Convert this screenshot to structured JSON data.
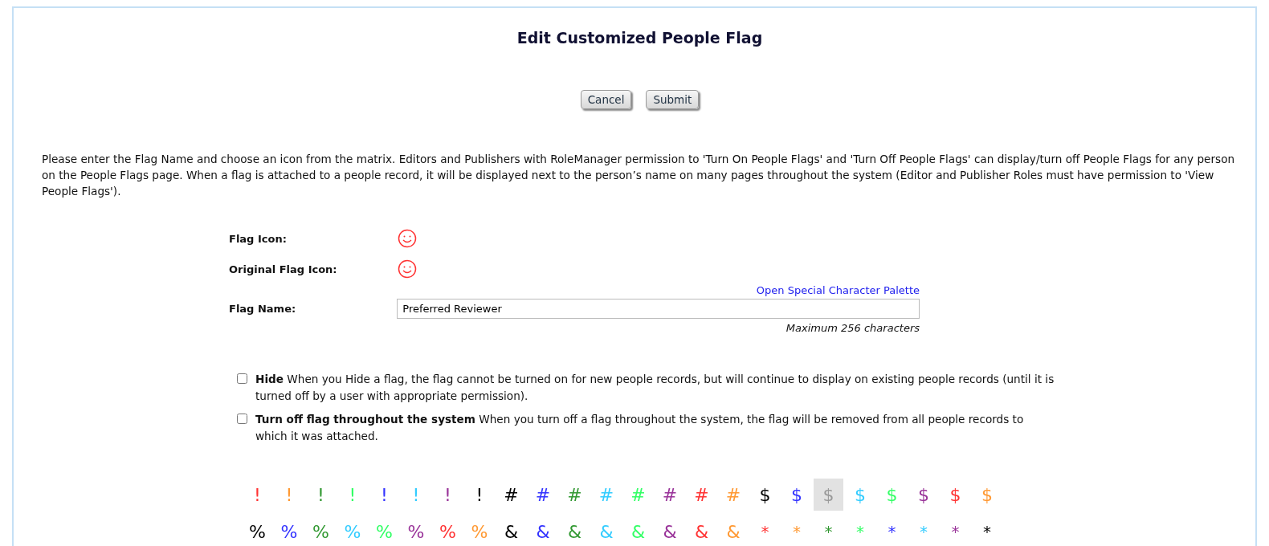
{
  "title": "Edit Customized People Flag",
  "buttons": [
    {
      "label": "Cancel"
    },
    {
      "label": "Submit"
    }
  ],
  "instructions": "Please enter the Flag Name and choose an icon from the matrix. Editors and Publishers with RoleManager permission to 'Turn On People Flags' and 'Turn Off People Flags' can display/turn off People Flags for any person on the People Flags page. When a flag is attached to a people record, it will be displayed next to the person’s name on many pages throughout the system (Editor and Publisher Roles must have permission to 'View People Flags').",
  "flag_icon": {
    "label": "Flag Icon:",
    "color": "#ff3333"
  },
  "original_flag_icon": {
    "label": "Original Flag Icon:",
    "color": "#ff3333"
  },
  "palette_link": "Open Special Character Palette",
  "flag_name": {
    "label": "Flag Name:",
    "value": "Preferred Reviewer",
    "hint": "Maximum 256 characters"
  },
  "options": [
    {
      "title": "Hide",
      "text": "When you Hide a flag, the flag cannot be turned on for new people records, but will continue to display on existing people records (until it is turned off by a user with appropriate permission).",
      "checked": false
    },
    {
      "title": "Turn off flag throughout the system",
      "text": "When you turn off a flag throughout the system, the flag will be removed from all people records to which it was attached.",
      "checked": false
    }
  ],
  "icon_matrix": [
    [
      {
        "char": "!",
        "color": "#ff3333",
        "selected": false
      },
      {
        "char": "!",
        "color": "#ff9933",
        "selected": false
      },
      {
        "char": "!",
        "color": "#339933",
        "selected": false
      },
      {
        "char": "!",
        "color": "#33ff66",
        "selected": false
      },
      {
        "char": "!",
        "color": "#3333ff",
        "selected": false
      },
      {
        "char": "!",
        "color": "#33ccff",
        "selected": false
      },
      {
        "char": "!",
        "color": "#993399",
        "selected": false
      },
      {
        "char": "!",
        "color": "#000000",
        "selected": false
      },
      {
        "char": "#",
        "color": "#000000",
        "selected": false
      },
      {
        "char": "#",
        "color": "#3333ff",
        "selected": false
      },
      {
        "char": "#",
        "color": "#339933",
        "selected": false
      },
      {
        "char": "#",
        "color": "#33ccff",
        "selected": false
      },
      {
        "char": "#",
        "color": "#33ff66",
        "selected": false
      },
      {
        "char": "#",
        "color": "#993399",
        "selected": false
      },
      {
        "char": "#",
        "color": "#ff3333",
        "selected": false
      },
      {
        "char": "#",
        "color": "#ff9933",
        "selected": false
      },
      {
        "char": "$",
        "color": "#000000",
        "selected": false
      },
      {
        "char": "$",
        "color": "#3333ff",
        "selected": false
      },
      {
        "char": "$",
        "color": "#999999",
        "selected": true
      },
      {
        "char": "$",
        "color": "#33ccff",
        "selected": false
      },
      {
        "char": "$",
        "color": "#33ff66",
        "selected": false
      },
      {
        "char": "$",
        "color": "#993399",
        "selected": false
      },
      {
        "char": "$",
        "color": "#ff3333",
        "selected": false
      },
      {
        "char": "$",
        "color": "#ff9933",
        "selected": false
      }
    ],
    [
      {
        "char": "%",
        "color": "#000000",
        "selected": false
      },
      {
        "char": "%",
        "color": "#3333ff",
        "selected": false
      },
      {
        "char": "%",
        "color": "#339933",
        "selected": false
      },
      {
        "char": "%",
        "color": "#33ccff",
        "selected": false
      },
      {
        "char": "%",
        "color": "#33ff66",
        "selected": false
      },
      {
        "char": "%",
        "color": "#993399",
        "selected": false
      },
      {
        "char": "%",
        "color": "#ff3333",
        "selected": false
      },
      {
        "char": "%",
        "color": "#ff9933",
        "selected": false
      },
      {
        "char": "&",
        "color": "#000000",
        "selected": false
      },
      {
        "char": "&",
        "color": "#3333ff",
        "selected": false
      },
      {
        "char": "&",
        "color": "#339933",
        "selected": false
      },
      {
        "char": "&",
        "color": "#33ccff",
        "selected": false
      },
      {
        "char": "&",
        "color": "#33ff66",
        "selected": false
      },
      {
        "char": "&",
        "color": "#993399",
        "selected": false
      },
      {
        "char": "&",
        "color": "#ff3333",
        "selected": false
      },
      {
        "char": "&",
        "color": "#ff9933",
        "selected": false
      },
      {
        "char": "*",
        "color": "#ff3333",
        "selected": false
      },
      {
        "char": "*",
        "color": "#ff9933",
        "selected": false
      },
      {
        "char": "*",
        "color": "#339933",
        "selected": false
      },
      {
        "char": "*",
        "color": "#33ff66",
        "selected": false
      },
      {
        "char": "*",
        "color": "#3333ff",
        "selected": false
      },
      {
        "char": "*",
        "color": "#33ccff",
        "selected": false
      },
      {
        "char": "*",
        "color": "#993399",
        "selected": false
      },
      {
        "char": "*",
        "color": "#000000",
        "selected": false
      }
    ]
  ]
}
